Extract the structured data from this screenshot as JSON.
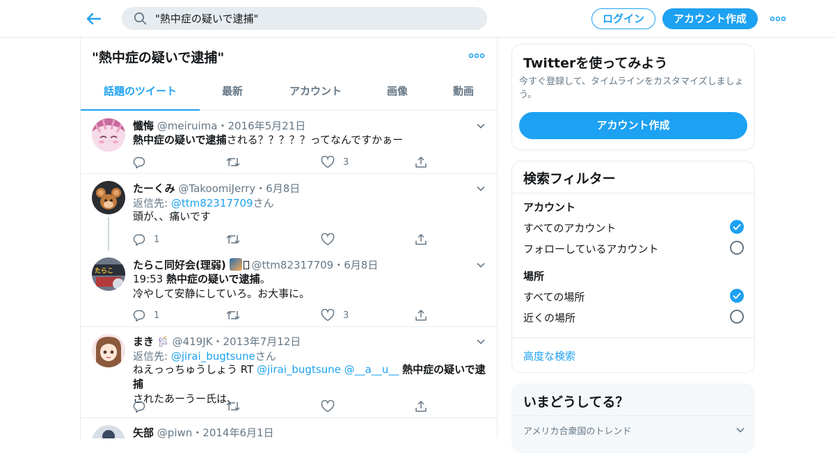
{
  "search": {
    "query": "\"熱中症の疑いで逮捕\""
  },
  "header": {
    "login_label": "ログイン",
    "signup_label": "アカウント作成"
  },
  "main": {
    "title": "\"熱中症の疑いで逮捕\"",
    "tabs": [
      {
        "label": "話題のツイート",
        "active": true
      },
      {
        "label": "最新"
      },
      {
        "label": "アカウント"
      },
      {
        "label": "画像"
      },
      {
        "label": "動画"
      }
    ],
    "tweets": [
      {
        "name": "懺悔",
        "handle": "@meiruima",
        "date": "2016年5月21日",
        "text_bold": "熱中症の疑いで逮捕",
        "text_rest": "される？？？？？ってなんですかぁー",
        "replies": "",
        "likes": "3"
      },
      {
        "name": "たーくみ",
        "handle": "@TakoomiJerry",
        "date": "6月8日",
        "reply_prefix": "返信先: ",
        "reply_to": "@ttm82317709",
        "reply_suffix": "さん",
        "text": "頭が、、痛いです",
        "replies": "1",
        "likes": ""
      },
      {
        "name": "たらこ同好会(理弱)",
        "handle": "@ttm82317709",
        "date": "6月8日",
        "text_prefix": "19:53 ",
        "text_bold": "熱中症の疑いで逮捕",
        "text_suffix": "。",
        "text_line2": "冷やして安静にしていろ。お大事に。",
        "replies": "1",
        "likes": "3"
      },
      {
        "name": "まき",
        "handle": "@419JK",
        "date": "2013年7月12日",
        "reply_prefix": "返信先: ",
        "reply_to": "@jirai_bugtsune",
        "reply_suffix": "さん",
        "text_prefix": "ねえっっちゅうしょう RT ",
        "mention1": "@jirai_bugtsune",
        "mention2": "@__a__u__",
        "text_bold": "熱中症の疑いで逮捕",
        "text_line2": "されたあーうー氏は、",
        "replies": "",
        "likes": ""
      },
      {
        "name": "矢部",
        "handle": "@piwn",
        "date": "2014年6月1日"
      }
    ],
    "dot": "・"
  },
  "sidebar": {
    "signup_card": {
      "title": "Twitterを使ってみよう",
      "subtitle": "今すぐ登録して、タイムラインをカスタマイズしましょう。",
      "button": "アカウント作成"
    },
    "filter_card": {
      "title": "検索フィルター",
      "account_heading": "アカウント",
      "account_options": [
        "すべてのアカウント",
        "フォローしているアカウント"
      ],
      "place_heading": "場所",
      "place_options": [
        "すべての場所",
        "近くの場所"
      ],
      "advanced_link": "高度な検索"
    },
    "trends_card": {
      "title": "いまどうしてる？",
      "location": "アメリカ合衆国のトレンド"
    }
  },
  "colors": {
    "accent": "#1da1f2",
    "text": "#14171a",
    "muted": "#657786",
    "border": "#e6ecf0",
    "like": "#e0245e"
  }
}
